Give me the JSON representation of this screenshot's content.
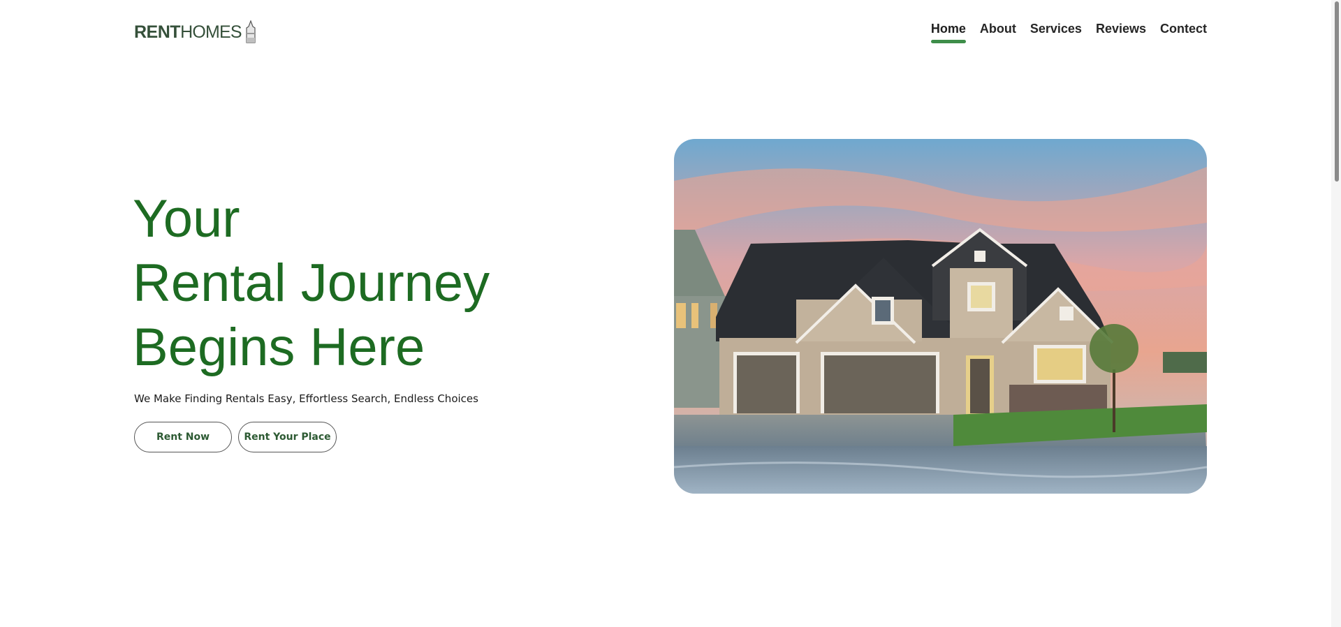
{
  "brand": {
    "name_bold": "RENT",
    "name_light": "HOMES",
    "icon": "bottle-tower-icon",
    "color": "#35503a"
  },
  "nav": {
    "items": [
      {
        "label": "Home",
        "active": true
      },
      {
        "label": "About",
        "active": false
      },
      {
        "label": "Services",
        "active": false
      },
      {
        "label": "Reviews",
        "active": false
      },
      {
        "label": "Contect",
        "active": false
      }
    ],
    "active_underline_color": "#3e8e4a"
  },
  "hero": {
    "title_lines": [
      "Your",
      "Rental Journey",
      "Begins Here"
    ],
    "title_color": "#1d6b22",
    "subtitle": "We Make Finding Rentals Easy, Effortless Search, Endless Choices",
    "buttons": {
      "rent_now": "Rent Now",
      "rent_your_place": "Rent Your Place"
    },
    "image": "suburban-house-at-sunset"
  }
}
